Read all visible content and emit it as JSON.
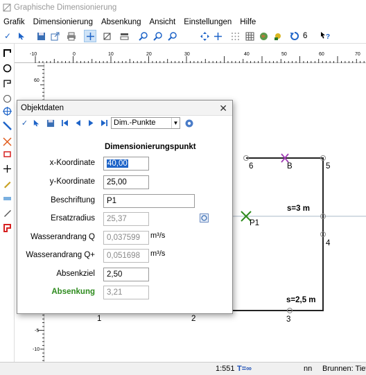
{
  "window": {
    "title": "Graphische Dimensionierung"
  },
  "menu": [
    "Grafik",
    "Dimensionierung",
    "Absenkung",
    "Ansicht",
    "Einstellungen",
    "Hilfe"
  ],
  "toolbar": {
    "undo_count": "6"
  },
  "ruler": {
    "top_ticks": [
      "-10",
      "0",
      "10",
      "20",
      "30",
      "40",
      "50",
      "60",
      "70"
    ],
    "left_ticks": [
      "60",
      "50",
      "-5",
      "-10"
    ]
  },
  "canvas": {
    "point_labels": {
      "p6": "6",
      "pB": "B",
      "p5": "5",
      "p4": "4",
      "p3": "3",
      "p1": "1",
      "p2": "2",
      "pP1": "P1"
    },
    "s_label_1": "s=3 m",
    "s_label_2": "s=2,5 m"
  },
  "dialog": {
    "title": "Objektdaten",
    "select_value": "Dim.-Punkte",
    "heading": "Dimensionierungspunkt",
    "fields": {
      "x": {
        "label": "x-Koordinate",
        "value": "40,00"
      },
      "y": {
        "label": "y-Koordinate",
        "value": "25,00"
      },
      "beschriftung": {
        "label": "Beschriftung",
        "value": "P1"
      },
      "ersatzradius": {
        "label": "Ersatzradius",
        "value": "25,37"
      },
      "q": {
        "label": "Wasserandrang Q",
        "value": "0,037599",
        "unit": "m³/s"
      },
      "qplus": {
        "label": "Wasserandrang Q+",
        "value": "0,051698",
        "unit": "m³/s"
      },
      "absenkziel": {
        "label": "Absenkziel",
        "value": "2,50"
      },
      "absenkung": {
        "label": "Absenkung",
        "value": "3,21"
      }
    }
  },
  "status": {
    "scale": "1:551",
    "t": "T=∞",
    "nn": "nn",
    "brunnen": "Brunnen: Tiefb"
  },
  "colors": {
    "accent": "#1e64c8",
    "green": "#2e8b1e",
    "purple": "#a03cb4"
  }
}
